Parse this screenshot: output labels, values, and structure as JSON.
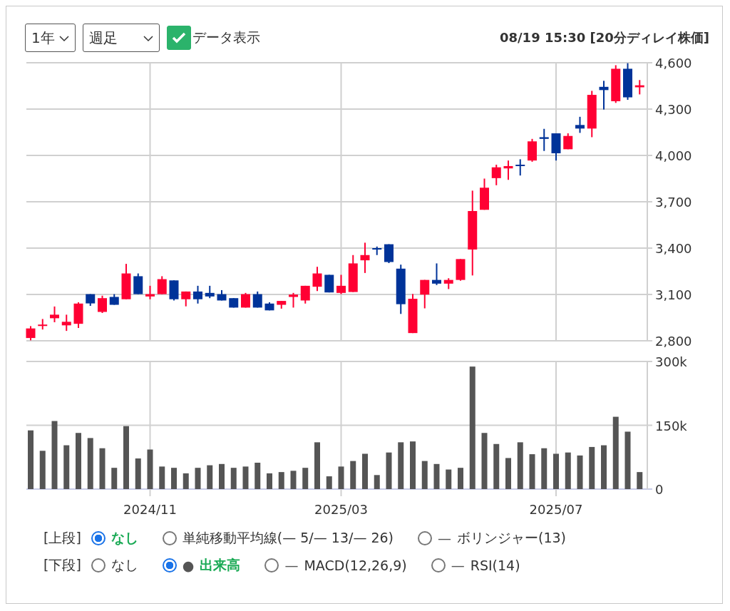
{
  "controls": {
    "period": "1年",
    "interval": "週足",
    "data_display": {
      "label": "データ表示",
      "checked": true
    },
    "timestamp": "08/19 15:30 [20分ディレイ株価]"
  },
  "price_chart": {
    "chart_data": {
      "type": "candlestick",
      "ylim": [
        2800,
        4600
      ],
      "grid": true,
      "yticks": [
        {
          "value": 4600,
          "label": "4,600"
        },
        {
          "value": 4300,
          "label": "4,300"
        },
        {
          "value": 4000,
          "label": "4,000"
        },
        {
          "value": 3700,
          "label": "3,700"
        },
        {
          "value": 3400,
          "label": "3,400"
        },
        {
          "value": 3100,
          "label": "3,100"
        },
        {
          "value": 2800,
          "label": "2,800"
        }
      ],
      "categories": [
        null,
        null,
        null,
        null,
        null,
        null,
        null,
        null,
        null,
        null,
        null,
        null,
        null,
        null,
        null,
        null,
        null,
        null,
        null,
        null,
        null,
        null,
        null,
        null,
        null,
        null,
        null,
        null,
        null,
        null,
        null,
        null,
        null,
        null,
        null,
        null,
        null,
        null,
        null,
        null,
        null,
        null,
        null,
        null,
        null,
        null,
        null,
        null,
        null,
        null,
        null,
        null
      ],
      "ohlc": [
        [
          2818,
          2895,
          2803,
          2880
        ],
        [
          2900,
          2941,
          2873,
          2905
        ],
        [
          2946,
          3022,
          2920,
          2969
        ],
        [
          2900,
          2969,
          2864,
          2923
        ],
        [
          2910,
          3049,
          2883,
          3041
        ],
        [
          3102,
          3102,
          3026,
          3042
        ],
        [
          2987,
          3092,
          2980,
          3076
        ],
        [
          3084,
          3102,
          3033,
          3033
        ],
        [
          3069,
          3298,
          3069,
          3236
        ],
        [
          3218,
          3236,
          3102,
          3102
        ],
        [
          3087,
          3156,
          3069,
          3102
        ],
        [
          3102,
          3218,
          3102,
          3199
        ],
        [
          3191,
          3191,
          3061,
          3069
        ],
        [
          3069,
          3119,
          3023,
          3119
        ],
        [
          3119,
          3156,
          3041,
          3069
        ],
        [
          3110,
          3156,
          3076,
          3087
        ],
        [
          3102,
          3128,
          3061,
          3061
        ],
        [
          3076,
          3076,
          3015,
          3015
        ],
        [
          3015,
          3110,
          3015,
          3102
        ],
        [
          3102,
          3119,
          3015,
          3015
        ],
        [
          3041,
          3049,
          2997,
          2997
        ],
        [
          3033,
          3058,
          3008,
          3058
        ],
        [
          3084,
          3110,
          3015,
          3099
        ],
        [
          3061,
          3156,
          3041,
          3156
        ],
        [
          3150,
          3279,
          3122,
          3236
        ],
        [
          3227,
          3227,
          3113,
          3113
        ],
        [
          3110,
          3227,
          3102,
          3156
        ],
        [
          3116,
          3355,
          3116,
          3301
        ],
        [
          3321,
          3435,
          3239,
          3355
        ],
        [
          3400,
          3410,
          3355,
          3393
        ],
        [
          3425,
          3425,
          3303,
          3310
        ],
        [
          3267,
          3293,
          2974,
          3037
        ],
        [
          2850,
          3103,
          2850,
          3072
        ],
        [
          3099,
          3194,
          3010,
          3194
        ],
        [
          3194,
          3301,
          3161,
          3170
        ],
        [
          3170,
          3205,
          3135,
          3194
        ],
        [
          3194,
          3329,
          3189,
          3329
        ],
        [
          3391,
          3772,
          3223,
          3640
        ],
        [
          3648,
          3850,
          3648,
          3791
        ],
        [
          3853,
          3940,
          3807,
          3923
        ],
        [
          3916,
          3967,
          3842,
          3931
        ],
        [
          3940,
          3975,
          3870,
          3931
        ],
        [
          3967,
          4107,
          3959,
          4091
        ],
        [
          4118,
          4172,
          4029,
          4107
        ],
        [
          4143,
          4143,
          3967,
          4014
        ],
        [
          4040,
          4143,
          4040,
          4126
        ],
        [
          4197,
          4250,
          4146,
          4174
        ],
        [
          4174,
          4418,
          4118,
          4392
        ],
        [
          4444,
          4483,
          4297,
          4423
        ],
        [
          4351,
          4584,
          4340,
          4561
        ],
        [
          4561,
          4597,
          4360,
          4376
        ],
        [
          4441,
          4488,
          4395,
          4454
        ]
      ]
    }
  },
  "volume_chart": {
    "chart_data": {
      "type": "bar",
      "ylim": [
        0,
        300
      ],
      "grid": true,
      "yticks": [
        {
          "value": 300,
          "label": "300k"
        },
        {
          "value": 150,
          "label": "150k"
        },
        {
          "value": 0,
          "label": "0"
        }
      ],
      "categories": [
        null,
        null,
        null,
        null,
        null,
        null,
        null,
        null,
        null,
        null,
        "2024/11",
        null,
        null,
        null,
        null,
        null,
        null,
        null,
        null,
        null,
        null,
        null,
        null,
        null,
        null,
        null,
        "2025/03",
        null,
        null,
        null,
        null,
        null,
        null,
        null,
        null,
        null,
        null,
        null,
        null,
        null,
        null,
        null,
        null,
        null,
        "2025/07",
        null,
        null,
        null,
        null,
        null,
        null,
        null
      ],
      "values": [
        138,
        90,
        160,
        103,
        132,
        120,
        96,
        50,
        148,
        72,
        93,
        53,
        50,
        37,
        50,
        56,
        59,
        50,
        53,
        62,
        37,
        40,
        43,
        50,
        110,
        30,
        53,
        66,
        83,
        33,
        86,
        110,
        112,
        66,
        59,
        46,
        50,
        288,
        132,
        106,
        73,
        110,
        82,
        96,
        83,
        86,
        79,
        99,
        103,
        170,
        135,
        40
      ]
    }
  },
  "legend": [
    {
      "label": "[上段]",
      "options": [
        {
          "label": "なし",
          "selected": true
        },
        {
          "label": "単純移動平均線(— 5/— 13/— 26)",
          "selected": false
        },
        {
          "icon": "—",
          "label": "ボリンジャー(13)",
          "selected": false
        }
      ]
    },
    {
      "label": "[下段]",
      "options": [
        {
          "label": "なし",
          "selected": false
        },
        {
          "icon": "●",
          "label": "出来高",
          "selected": true
        },
        {
          "icon": "—",
          "label": "MACD(12,26,9)",
          "selected": false
        },
        {
          "icon": "—",
          "label": "RSI(14)",
          "selected": false
        }
      ]
    }
  ]
}
